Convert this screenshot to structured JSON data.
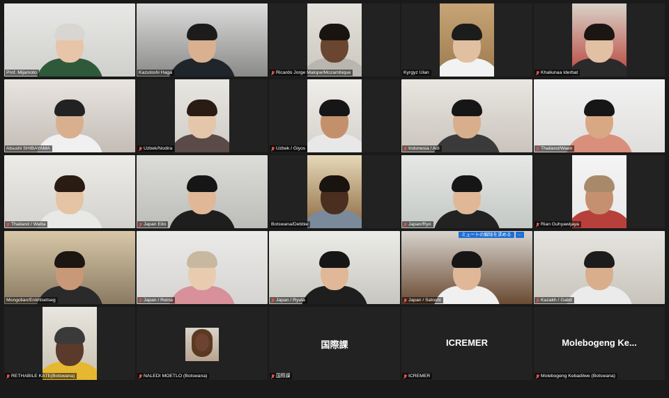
{
  "meeting": {
    "unmute_request_label": "ミュートの解除を求める",
    "more_label": "···"
  },
  "participants": [
    {
      "name": "Prof. Mijamoto",
      "muted": false,
      "style": {
        "bg1": "#e8e8e6",
        "bg2": "#cfcfcc",
        "skin": "#e8c4a8",
        "hair": "#d9d5d0",
        "shirt": "#2e5a3a"
      }
    },
    {
      "name": "Kazutoshi Haga",
      "muted": false,
      "speaking": true,
      "style": {
        "bg1": "#dcdcdc",
        "bg2": "#8a8a88",
        "skin": "#d9b090",
        "hair": "#1c1c1c",
        "shirt": "#20242b"
      }
    },
    {
      "name": "Ricardo Jorge Malope/Mozambique",
      "muted": true,
      "narrow": true,
      "style": {
        "bg1": "#e4e2dc",
        "bg2": "#cbc7bd",
        "skin": "#6a4530",
        "hair": "#1a1410",
        "shirt": "#b8b6ae"
      }
    },
    {
      "name": "Kyrgyz Ulan",
      "muted": false,
      "narrow": true,
      "style": {
        "bg1": "#c7a576",
        "bg2": "#9c7a4e",
        "skin": "#e0c0a0",
        "hair": "#1c1c1c",
        "shirt": "#f2f2f2"
      }
    },
    {
      "name": "Khaliunaa Iderbat",
      "muted": true,
      "narrow": true,
      "style": {
        "bg1": "#d8d2c8",
        "bg2": "#b8433a",
        "skin": "#e2c0a4",
        "hair": "#1c1612",
        "shirt": "#2a2a2a"
      }
    },
    {
      "name": "Atsushi SHIBAYAMA",
      "muted": false,
      "style": {
        "bg1": "#e8e4e0",
        "bg2": "#c4bdb6",
        "skin": "#d8b090",
        "hair": "#222222",
        "shirt": "#f0f0f0"
      }
    },
    {
      "name": "Uzbek/Nodira",
      "muted": true,
      "narrow": true,
      "style": {
        "bg1": "#e8e6e2",
        "bg2": "#d0ccc6",
        "skin": "#e4c6aa",
        "hair": "#2a1c14",
        "shirt": "#5a4a48"
      }
    },
    {
      "name": "Uzbek / Giyos",
      "muted": true,
      "narrow": true,
      "style": {
        "bg1": "#f0eeea",
        "bg2": "#d4d0cc",
        "skin": "#c4906c",
        "hair": "#161616",
        "shirt": "#e8e8e8"
      }
    },
    {
      "name": "Indonesia / Adi",
      "muted": true,
      "style": {
        "bg1": "#e8e6e0",
        "bg2": "#cac4bc",
        "skin": "#d8ae8c",
        "hair": "#161616",
        "shirt": "#3a3a3a"
      }
    },
    {
      "name": "Thailand/Waen",
      "muted": true,
      "style": {
        "bg1": "#f2f2f2",
        "bg2": "#e0dedc",
        "skin": "#d8a884",
        "hair": "#161616",
        "shirt": "#d98f7c"
      }
    },
    {
      "name": "Thailand / Watta",
      "muted": true,
      "style": {
        "bg1": "#ecebe8",
        "bg2": "#d4d2ce",
        "skin": "#e4c4a4",
        "hair": "#2a1c12",
        "shirt": "#e8e8e6"
      }
    },
    {
      "name": "Japan Eito",
      "muted": true,
      "style": {
        "bg1": "#dcdcd8",
        "bg2": "#bcbcb8",
        "skin": "#e0b898",
        "hair": "#161616",
        "shirt": "#1e1e1e"
      }
    },
    {
      "name": "Botswana/Debbie",
      "muted": false,
      "narrow": true,
      "style": {
        "bg1": "#e6d8b8",
        "bg2": "#8c6a42",
        "skin": "#4a2e20",
        "hair": "#1a1410",
        "shirt": "#7a8a9a"
      }
    },
    {
      "name": "Japan/Ryo",
      "muted": true,
      "style": {
        "bg1": "#e6e8e6",
        "bg2": "#c4c8c4",
        "skin": "#e0b898",
        "hair": "#161616",
        "shirt": "#222222"
      }
    },
    {
      "name": "Rian Guhyawijaya",
      "muted": true,
      "narrow": true,
      "style": {
        "bg1": "#f4f4f4",
        "bg2": "#e8e8e8",
        "skin": "#c49070",
        "hair": "#a88a6a",
        "shirt": "#b8403a"
      }
    },
    {
      "name": "Mongolian/Enkhtsetseg",
      "muted": false,
      "style": {
        "bg1": "#d8c8a8",
        "bg2": "#8a7a62",
        "skin": "#c89878",
        "hair": "#1c1612",
        "shirt": "#2a2a2a"
      }
    },
    {
      "name": "Japan / Reina",
      "muted": true,
      "style": {
        "bg1": "#eaeae8",
        "bg2": "#d6d4d2",
        "skin": "#e8ccb0",
        "hair": "#c8b8a0",
        "shirt": "#d8909a"
      }
    },
    {
      "name": "Japan / Ryuta",
      "muted": true,
      "style": {
        "bg1": "#ecece8",
        "bg2": "#c8c6c0",
        "skin": "#e0b898",
        "hair": "#161616",
        "shirt": "#1e1e1e"
      }
    },
    {
      "name": "Japan / Satoshi",
      "muted": true,
      "request": true,
      "style": {
        "bg1": "#d8d4ce",
        "bg2": "#6a4a32",
        "skin": "#e0b898",
        "hair": "#161616",
        "shirt": "#f0f0f0"
      }
    },
    {
      "name": "Kazakh / Gabit",
      "muted": true,
      "style": {
        "bg1": "#e6e4e0",
        "bg2": "#c8c4bc",
        "skin": "#d8ae8c",
        "hair": "#1c1c1c",
        "shirt": "#ebebeb"
      }
    },
    {
      "name": "RETHABILE KATE(Botswana)",
      "muted": true,
      "narrow": true,
      "style": {
        "bg1": "#e8e6e0",
        "bg2": "#c8c0b0",
        "skin": "#5a3a2a",
        "hair": "#3a3a3a",
        "shirt": "#e6b830"
      }
    },
    {
      "name": "NALEDI MOETLO (Botswana)",
      "muted": true,
      "avatar_photo": true
    },
    {
      "name": "国際課",
      "muted": true,
      "display_name": "国際課"
    },
    {
      "name": "ICREMER",
      "muted": true,
      "display_name": "ICREMER"
    },
    {
      "name": "Molebogeng Kebadilwe (Botswana)",
      "muted": true,
      "display_name": "Molebogeng  Ke..."
    }
  ]
}
